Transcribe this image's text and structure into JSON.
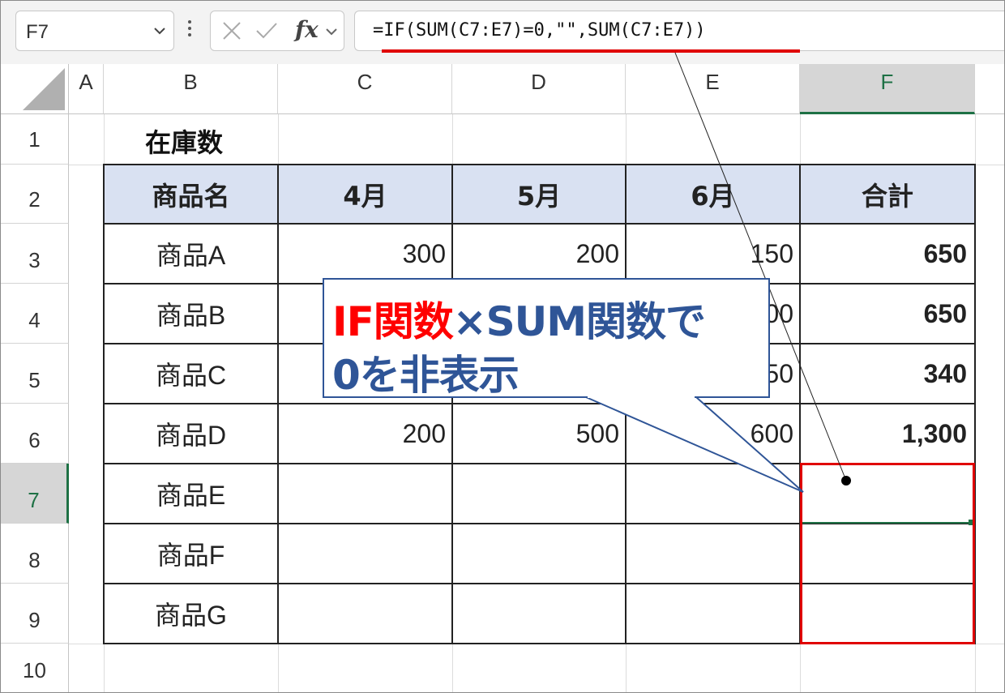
{
  "name_box": {
    "value": "F7"
  },
  "formula_bar": {
    "formula": "=IF(SUM(C7:E7)=0,\"\",SUM(C7:E7))",
    "fx_label": "fx"
  },
  "columns": [
    "A",
    "B",
    "C",
    "D",
    "E",
    "F"
  ],
  "rows": [
    "1",
    "2",
    "3",
    "4",
    "5",
    "6",
    "7",
    "8",
    "9",
    "10"
  ],
  "sheet": {
    "title": "在庫数",
    "headers": [
      "商品名",
      "4月",
      "5月",
      "6月",
      "合計"
    ],
    "products": [
      "商品A",
      "商品B",
      "商品C",
      "商品D",
      "商品E",
      "商品F",
      "商品G"
    ],
    "values": {
      "r3": [
        "300",
        "200",
        "150",
        "650"
      ],
      "r4": [
        "",
        "",
        "00",
        "650"
      ],
      "r5": [
        "",
        "",
        "50",
        "340"
      ],
      "r6": [
        "200",
        "500",
        "600",
        "1,300"
      ]
    }
  },
  "callout": {
    "part1": "IF関数",
    "part2": "×SUM関数で",
    "line2": "0を非表示"
  },
  "colors": {
    "accent_red": "#e00000",
    "callout_blue": "#2f5597",
    "header_fill": "#d9e1f2",
    "excel_green": "#1e7145"
  }
}
